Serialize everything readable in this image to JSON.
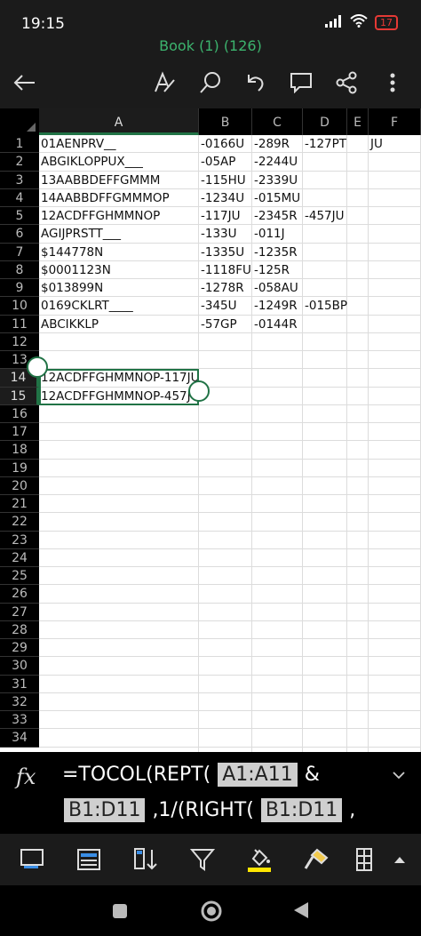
{
  "status": {
    "time": "19:15",
    "battery": "17"
  },
  "app": {
    "title": "Book (1) (126)"
  },
  "columns": [
    "A",
    "B",
    "C",
    "D",
    "E",
    "F"
  ],
  "rows": [
    "1",
    "2",
    "3",
    "4",
    "5",
    "6",
    "7",
    "8",
    "9",
    "10",
    "11",
    "12",
    "13",
    "14",
    "15",
    "16",
    "17",
    "18",
    "19",
    "20",
    "21",
    "22",
    "23",
    "24",
    "25",
    "26",
    "27",
    "28",
    "29",
    "30",
    "31",
    "32",
    "33",
    "34"
  ],
  "cells": {
    "A": [
      "01AENPRV__",
      "ABGIKLOPPUX___",
      "13AABBDEFFGMMM",
      "14AABBDFFGMMMOP",
      "12ACDFFGHMMNOP",
      "AGIJPRSTT___",
      "$144778N",
      "$0001123N",
      "$013899N",
      "0169CKLRT____",
      "ABCIKKLP",
      "",
      "",
      "12ACDFFGHMMNOP-117JU",
      "12ACDFFGHMMNOP-457JU"
    ],
    "B": [
      "-0166U",
      "-05AP",
      "-115HU",
      "-1234U",
      "-117JU",
      "-133U",
      "-1335U",
      "-1118FU",
      "-1278R",
      "-345U",
      "-57GP"
    ],
    "C": [
      "-289R",
      "-2244U",
      "-2339U",
      "-015MU",
      "-2345R",
      "-011J",
      "-1235R",
      "-125R",
      "-058AU",
      "-1249R",
      "-0144R"
    ],
    "D": [
      "-127PT",
      "",
      "",
      "",
      "-457JU",
      "",
      "",
      "",
      "",
      "-015BP",
      ""
    ],
    "E": [],
    "F": [
      "JU"
    ]
  },
  "formula": {
    "fx_label": "fx",
    "line1_prefix": "=TOCOL(REPT(",
    "line1_ref": "A1:A11",
    "line1_suffix": "&",
    "line2_ref1": "B1:D11",
    "line2_mid": ",1/(RIGHT(",
    "line2_ref2": "B1:D11",
    "line2_suffix": ","
  },
  "icons": {
    "back": "back-arrow-icon",
    "draw": "draw-pen-icon",
    "search": "search-icon",
    "undo": "undo-icon",
    "comment": "comment-icon",
    "share": "share-icon",
    "more": "more-vertical-icon"
  },
  "colors": {
    "accent": "#217346",
    "title": "#3cb46e",
    "battery": "#e53935",
    "fill": "#ffe600"
  }
}
